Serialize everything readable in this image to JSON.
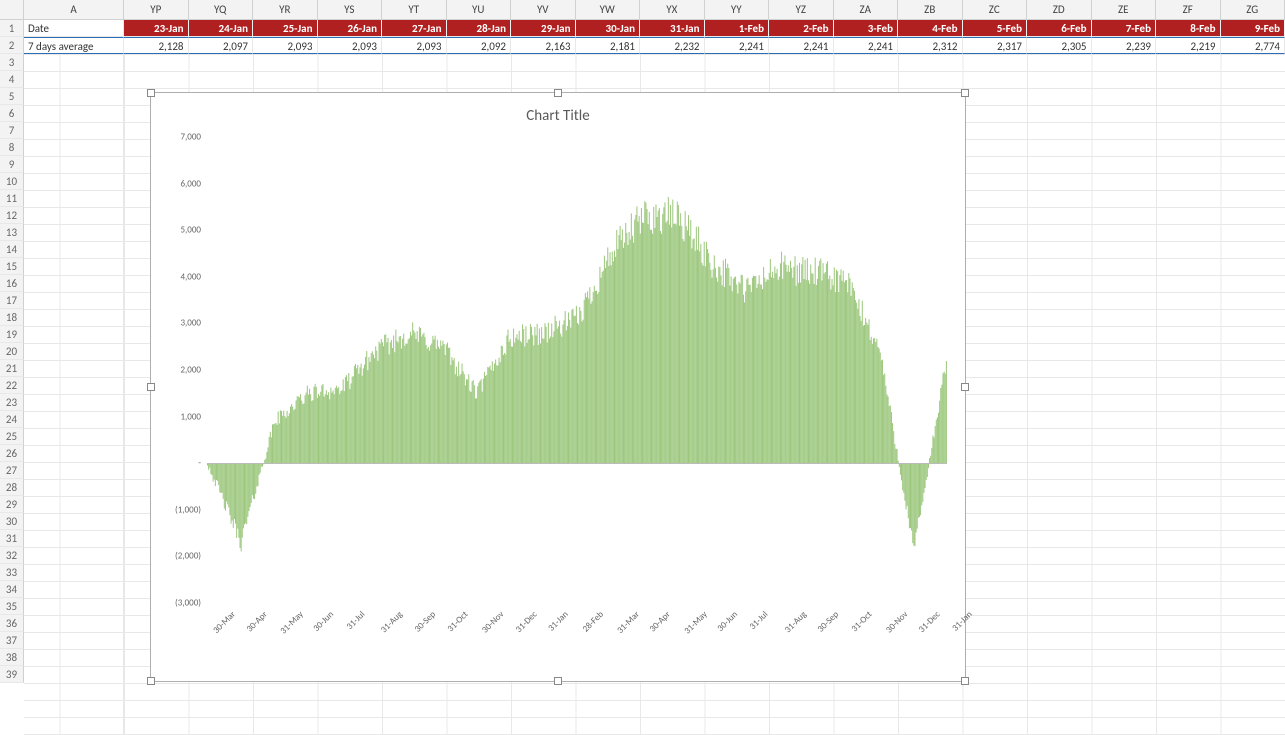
{
  "columns_letters": [
    "YP",
    "YQ",
    "YR",
    "YS",
    "YT",
    "YU",
    "YV",
    "YW",
    "YX",
    "YY",
    "YZ",
    "ZA",
    "ZB",
    "ZC",
    "ZD",
    "ZE",
    "ZF",
    "ZG"
  ],
  "first_col_letter": "A",
  "row_labels": {
    "r1": "Date",
    "r2": "7 days average"
  },
  "row1_values": [
    "23-Jan",
    "24-Jan",
    "25-Jan",
    "26-Jan",
    "27-Jan",
    "28-Jan",
    "29-Jan",
    "30-Jan",
    "31-Jan",
    "1-Feb",
    "2-Feb",
    "3-Feb",
    "4-Feb",
    "5-Feb",
    "6-Feb",
    "7-Feb",
    "8-Feb",
    "9-Feb"
  ],
  "row2_values": [
    "2,128",
    "2,097",
    "2,093",
    "2,093",
    "2,093",
    "2,092",
    "2,163",
    "2,181",
    "2,232",
    "2,241",
    "2,241",
    "2,241",
    "2,312",
    "2,317",
    "2,305",
    "2,239",
    "2,219",
    "2,774"
  ],
  "row_count_visible": 39,
  "chart": {
    "title": "Chart Title",
    "ylim": [
      -3000,
      7000
    ],
    "yticks": [
      7000,
      6000,
      5000,
      4000,
      3000,
      2000,
      1000,
      0,
      -1000,
      -2000,
      -3000
    ],
    "ytick_labels": [
      "7,000",
      "6,000",
      "5,000",
      "4,000",
      "3,000",
      "2,000",
      "1,000",
      "-",
      "(1,000)",
      "(2,000)",
      "(3,000)"
    ],
    "xtick_labels": [
      "30-Mar",
      "30-Apr",
      "31-May",
      "30-Jun",
      "31-Jul",
      "31-Aug",
      "30-Sep",
      "31-Oct",
      "30-Nov",
      "31-Dec",
      "31-Jan",
      "28-Feb",
      "31-Mar",
      "30-Apr",
      "31-May",
      "30-Jun",
      "31-Jul",
      "31-Aug",
      "30-Sep",
      "31-Oct",
      "30-Nov",
      "31-Dec",
      "31-Jan"
    ],
    "bar_color": "#9cc77d"
  },
  "chart_data": {
    "type": "bar",
    "title": "Chart Title",
    "xlabel": "",
    "ylabel": "",
    "ylim": [
      -3000,
      7000
    ],
    "categories_note": "x-axis spans ~680 daily bars from 30-Mar of year N to ~9-Feb of year N+2; labeled ticks at month ends",
    "xticks": [
      "30-Mar",
      "30-Apr",
      "31-May",
      "30-Jun",
      "31-Jul",
      "31-Aug",
      "30-Sep",
      "31-Oct",
      "30-Nov",
      "31-Dec",
      "31-Jan",
      "28-Feb",
      "31-Mar",
      "30-Apr",
      "31-May",
      "30-Jun",
      "31-Jul",
      "31-Aug",
      "30-Sep",
      "31-Oct",
      "30-Nov",
      "31-Dec",
      "31-Jan"
    ],
    "series": [
      {
        "name": "7 days average",
        "values_approx_at_month_ticks": [
          0,
          -1700,
          900,
          1500,
          1600,
          2400,
          2800,
          2500,
          1500,
          2700,
          2800,
          3100,
          4500,
          5300,
          5300,
          4300,
          3700,
          4200,
          4100,
          3900,
          2400,
          -1900,
          2300
        ],
        "notes": "approximate bar heights read at each labeled month tick; full daily series not individually readable"
      }
    ]
  }
}
